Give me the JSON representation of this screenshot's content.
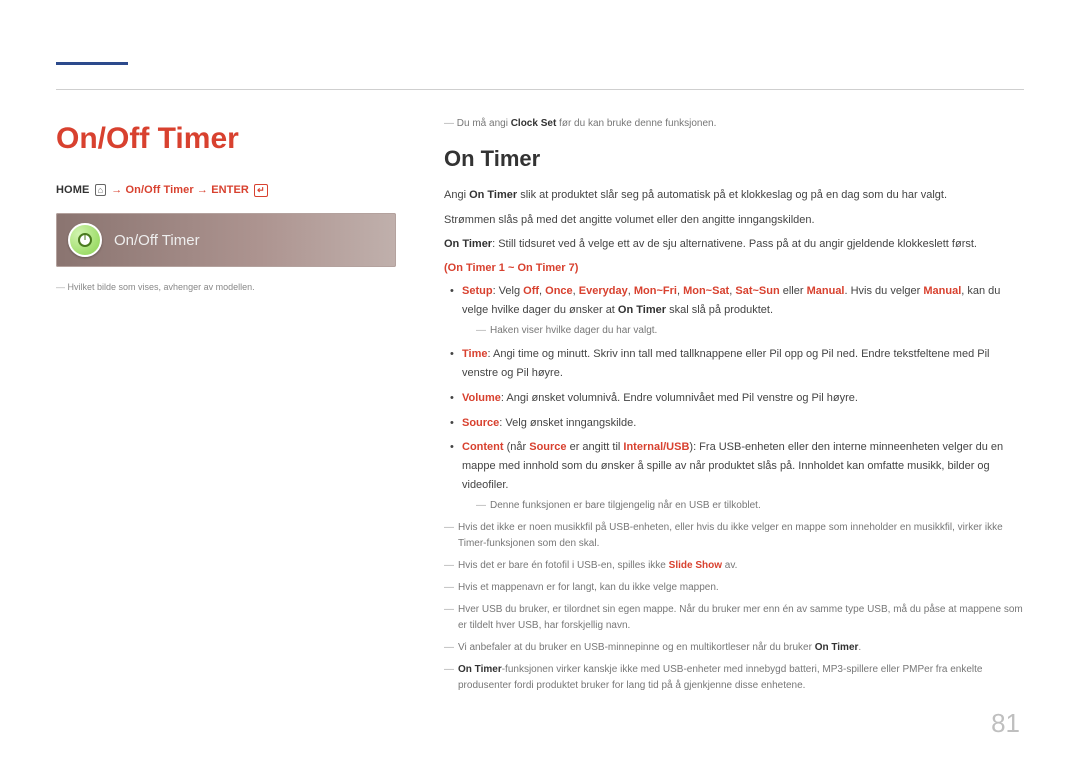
{
  "page_number": "81",
  "h1": "On/Off Timer",
  "breadcrumb": {
    "home": "HOME",
    "path": "On/Off Timer",
    "enter": "ENTER"
  },
  "menu_tile_label": "On/Off Timer",
  "left_footnote": "Hvilket bilde som vises, avhenger av modellen.",
  "top_note": {
    "pre": "Du må angi ",
    "bold": "Clock Set",
    "post": " før du kan bruke denne funksjonen."
  },
  "h2": "On Timer",
  "intro": [
    {
      "pre": "Angi ",
      "b": "On Timer",
      "post": " slik at produktet slår seg på automatisk på et klokkeslag og på en dag som du har valgt."
    },
    {
      "text": "Strømmen slås på med det angitte volumet eller den angitte inngangskilden."
    },
    {
      "b": "On Timer",
      "post": ": Still tidsuret ved å velge ett av de sju alternativene. Pass på at du angir gjeldende klokkeslett først."
    }
  ],
  "group_label": "(On Timer 1 ~ On Timer 7)",
  "bullets": [
    {
      "setup": {
        "label": "Setup",
        "text1": ": Velg ",
        "opts": [
          "Off",
          "Once",
          "Everyday",
          "Mon~Fri",
          "Mon~Sat",
          "Sat~Sun"
        ],
        "or": " eller ",
        "last": "Manual",
        "tail1": ". Hvis du velger ",
        "tail_b": "Manual",
        "tail2": ", kan du velge hvilke dager du ønsker at ",
        "tail_b2": "On Timer",
        "tail3": " skal slå på produktet."
      },
      "subnote": "Haken viser hvilke dager du har valgt."
    },
    {
      "time": {
        "label": "Time",
        "text": ": Angi time og minutt. Skriv inn tall med tallknappene eller Pil opp og Pil ned. Endre tekstfeltene med Pil venstre og Pil høyre."
      }
    },
    {
      "volume": {
        "label": "Volume",
        "text": ": Angi ønsket volumnivå. Endre volumnivået med Pil venstre og Pil høyre."
      }
    },
    {
      "source": {
        "label": "Source",
        "text": ": Velg ønsket inngangskilde."
      }
    },
    {
      "content": {
        "label": "Content",
        "pre": " (når ",
        "src": "Source",
        "mid": " er angitt til ",
        "iu": "Internal/USB",
        "post": "): Fra USB-enheten eller den interne minneenheten velger du en mappe med innhold som du ønsker å spille av når produktet slås på. Innholdet kan omfatte musikk, bilder og videofiler."
      },
      "subnote": "Denne funksjonen er bare tilgjengelig når en USB er tilkoblet."
    }
  ],
  "tail_notes": [
    {
      "text": "Hvis det ikke er noen musikkfil på USB-enheten, eller hvis du ikke velger en mappe som inneholder en musikkfil, virker ikke Timer-funksjonen som den skal."
    },
    {
      "pre": "Hvis det er bare én fotofil i USB-en, spilles ikke ",
      "b": "Slide Show",
      "post": " av."
    },
    {
      "text": "Hvis et mappenavn er for langt, kan du ikke velge mappen."
    },
    {
      "text": "Hver USB du bruker, er tilordnet sin egen mappe. Når du bruker mer enn én av samme type USB, må du påse at mappene som er tildelt hver USB, har forskjellig navn."
    },
    {
      "pre": "Vi anbefaler at du bruker en USB-minnepinne og en multikortleser når du bruker ",
      "b": "On Timer",
      "post": "."
    },
    {
      "b": "On Timer",
      "post": "-funksjonen virker kanskje ikke med USB-enheter med innebygd batteri, MP3-spillere eller PMPer fra enkelte produsenter fordi produktet bruker for lang tid på å gjenkjenne disse enhetene."
    }
  ]
}
